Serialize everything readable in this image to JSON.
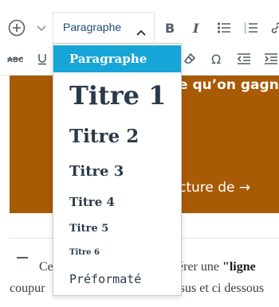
{
  "toolbar": {
    "format_value": "Paragraphe"
  },
  "dropdown": {
    "options": [
      {
        "label": "Paragraphe"
      },
      {
        "label": "Titre 1"
      },
      {
        "label": "Titre 2"
      },
      {
        "label": "Titre 3"
      },
      {
        "label": "Titre 4"
      },
      {
        "label": "Titre 5"
      },
      {
        "label": "Titre 6"
      },
      {
        "label": "Préformaté"
      }
    ]
  },
  "content": {
    "overlay_heading": "e qu’on gagne",
    "overlay_link": "cture de →",
    "paragraph_line1_start": "Ce",
    "paragraph_line1_mid": "sérer une ",
    "paragraph_line1_bold": "\"ligne",
    "paragraph_line2_start": "coupur",
    "paragraph_line2_end": "essus et ci dessous"
  },
  "colors": {
    "accent": "#17a5d8",
    "image_bg": "#a85a05",
    "icon": "#555d66"
  }
}
